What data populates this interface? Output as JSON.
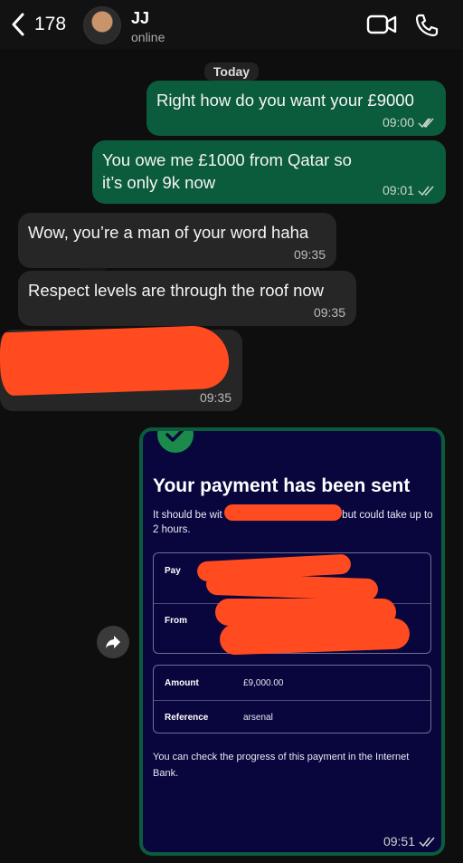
{
  "header": {
    "back_count": "178",
    "contact_name": "JJ",
    "contact_status": "online"
  },
  "chat": {
    "day_label": "Today",
    "messages": [
      {
        "text": "Right how do you want your £9000",
        "time": "09:00"
      },
      {
        "text": "You owe me £1000 from Qatar so it’s only 9k now",
        "time": "09:01"
      },
      {
        "text": "Wow, you’re a man of your word haha",
        "time": "09:35"
      },
      {
        "text": "Respect levels are through the roof now",
        "time": "09:35"
      },
      {
        "text": "",
        "time": "09:35"
      }
    ]
  },
  "payment_card": {
    "title": "Your payment has been sent",
    "subtitle_start": "It should be wit",
    "subtitle_end": "ow, but could take up to 2 hours.",
    "pay_label": "Pay",
    "from_label": "From",
    "amount_label": "Amount",
    "amount_value": "£9,000.00",
    "reference_label": "Reference",
    "reference_value": "arsenal",
    "footer_text": "You can check the progress of this payment in the Internet Bank.",
    "time": "09:51"
  },
  "colors": {
    "outgoing_bubble": "#0b5c3c",
    "incoming_bubble": "#262626",
    "card_background": "#09063d",
    "redaction": "#ff4b1f"
  }
}
